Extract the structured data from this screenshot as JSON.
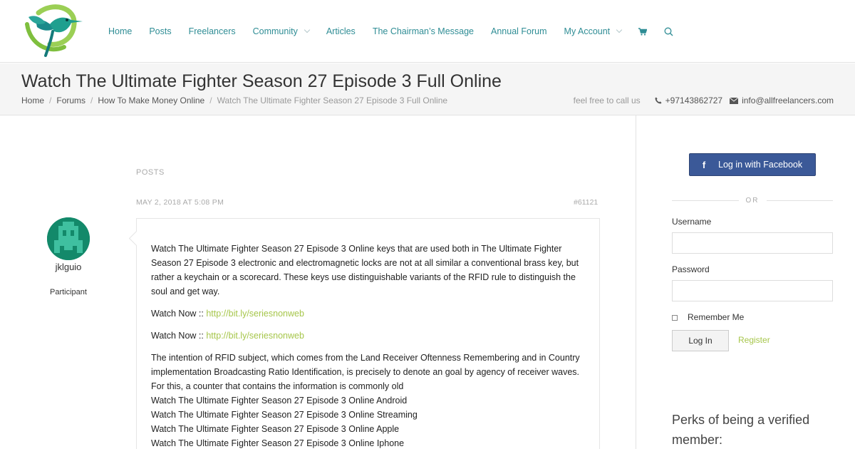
{
  "nav": {
    "items": [
      {
        "label": "Home",
        "dropdown": false
      },
      {
        "label": "Posts",
        "dropdown": false
      },
      {
        "label": "Freelancers",
        "dropdown": false
      },
      {
        "label": "Community",
        "dropdown": true
      },
      {
        "label": "Articles",
        "dropdown": false
      },
      {
        "label": "The Chairman’s Message",
        "dropdown": false
      },
      {
        "label": "Annual Forum",
        "dropdown": false
      },
      {
        "label": "My Account",
        "dropdown": true
      }
    ],
    "icons": [
      "cart-icon",
      "search-icon"
    ]
  },
  "page": {
    "title": "Watch The Ultimate Fighter Season 27 Episode 3 Full Online"
  },
  "breadcrumb": [
    "Home",
    "Forums",
    "How To Make Money Online",
    "Watch The Ultimate Fighter Season 27 Episode 3 Full Online"
  ],
  "contact": {
    "tagline": "feel free to call us",
    "phone": "+97143862727",
    "email": "info@allfreelancers.com"
  },
  "colors": {
    "accent": "#2f8d95",
    "link": "#a6c64a",
    "facebook": "#3b5998",
    "avatar": "#13896a"
  },
  "post": {
    "section_label": "POSTS",
    "date": "MAY 2, 2018 AT 5:08 PM",
    "id": "#61121",
    "author": {
      "name": "jklguio",
      "role": "Participant"
    },
    "body_intro": "Watch The Ultimate Fighter Season 27 Episode 3 Online keys that are used both in The Ultimate Fighter Season 27 Episode 3 electronic and electromagnetic locks are not at all similar a conventional brass key, but rather a keychain or a scorecard. These keys use distinguishable variants of the RFID rule to distinguish the soul and get way.",
    "watch_now_label": "Watch Now ::",
    "link_1": "http://bit.ly/seriesnonweb",
    "link_2": "http://bit.ly/seriesnonweb",
    "body_rfid": "The intention of RFID subject, which comes from the Land Receiver Oftenness Remembering and in Country implementation Broadcasting Ratio Identification, is precisely to denote an goal by agency of receiver waves. For this, a counter that contains the information is commonly old",
    "lines": [
      "Watch The Ultimate Fighter Season 27 Episode 3 Online Android",
      "Watch The Ultimate Fighter Season 27 Episode 3 Online Streaming",
      "Watch The Ultimate Fighter Season 27 Episode 3 Online Apple",
      "Watch The Ultimate Fighter Season 27 Episode 3 Online Iphone"
    ]
  },
  "login": {
    "facebook_label": "Log in with Facebook",
    "or": "OR",
    "username_label": "Username",
    "username_value": "",
    "password_label": "Password",
    "password_value": "",
    "remember_label": "Remember Me",
    "remember_checked": false,
    "login_button": "Log In",
    "register_link": "Register"
  },
  "perks": {
    "title": "Perks of being a verified member:"
  }
}
